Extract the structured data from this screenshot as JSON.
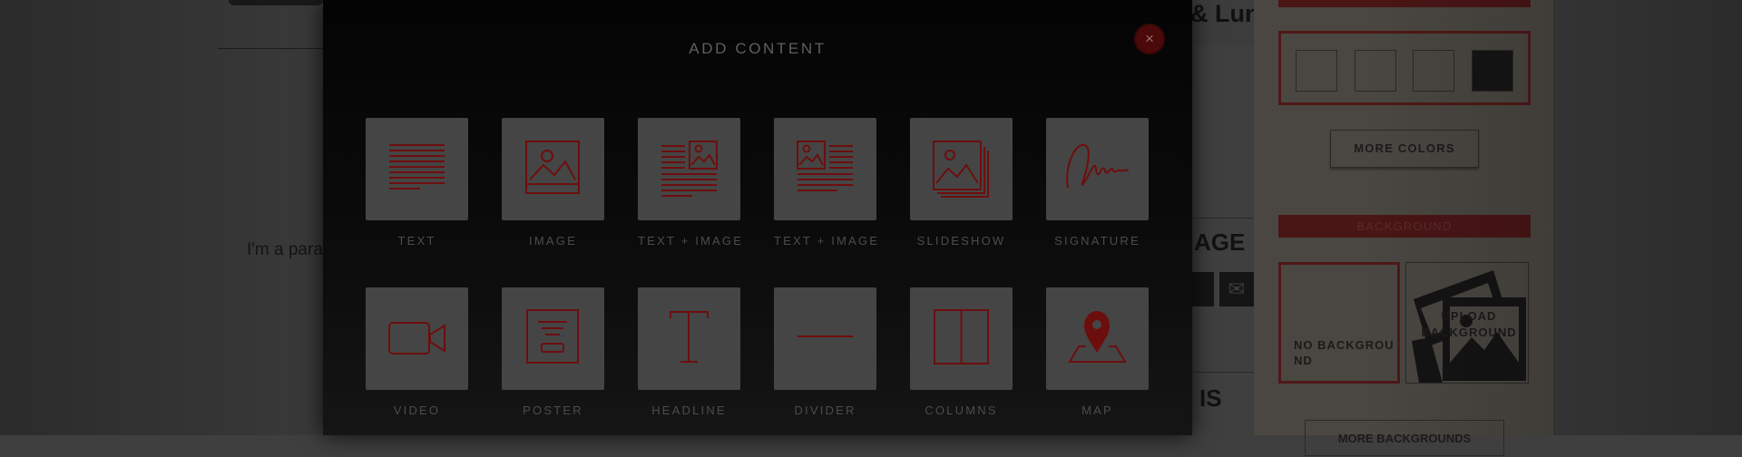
{
  "background_page": {
    "paragraph_text": "I'm a paragraph. Click here to add your own text and edit me. I'm a great place for you to tell a story and let your users know a little more about you.",
    "title_fragment": "& Lunc",
    "age_fragment": "AGE",
    "is_fragment": "IS",
    "mail_icon": "mail-icon"
  },
  "right_panel": {
    "more_colors_label": "MORE COLORS",
    "background_section_label": "BACKGROUND",
    "no_background_label": "NO BACKGROUND",
    "upload_background_label": "UPLOAD BACKGROUND",
    "more_backgrounds_label": "MORE BACKGROUNDS",
    "swatch_colors": [
      "#4a4742",
      "#4a4742",
      "#4a4742",
      "#151515"
    ]
  },
  "modal": {
    "title": "ADD CONTENT",
    "close_icon": "close-icon",
    "close_glyph": "×",
    "accent_color": "#6d0e0e",
    "items": [
      {
        "label": "TEXT",
        "icon": "text-lines-icon"
      },
      {
        "label": "IMAGE",
        "icon": "image-icon"
      },
      {
        "label": "TEXT + IMAGE",
        "icon": "text-image-right-icon"
      },
      {
        "label": "TEXT + IMAGE",
        "icon": "text-image-left-icon"
      },
      {
        "label": "SLIDESHOW",
        "icon": "slideshow-icon"
      },
      {
        "label": "SIGNATURE",
        "icon": "signature-icon"
      },
      {
        "label": "VIDEO",
        "icon": "video-camera-icon"
      },
      {
        "label": "POSTER",
        "icon": "poster-icon"
      },
      {
        "label": "HEADLINE",
        "icon": "headline-t-icon"
      },
      {
        "label": "DIVIDER",
        "icon": "divider-icon"
      },
      {
        "label": "COLUMNS",
        "icon": "columns-icon"
      },
      {
        "label": "MAP",
        "icon": "map-pin-icon"
      }
    ]
  }
}
